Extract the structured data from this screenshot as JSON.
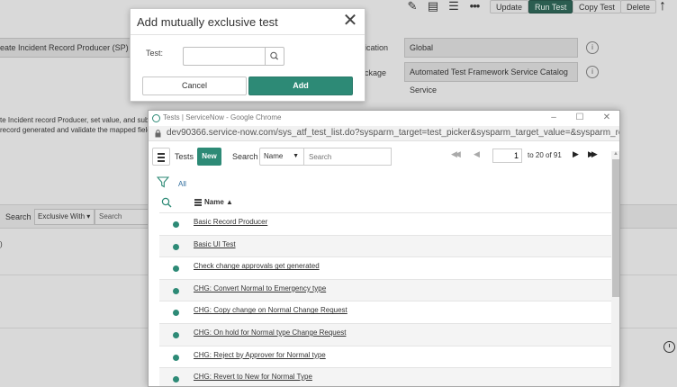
{
  "background": {
    "toolbar": {
      "update_label": "Update",
      "run_test_label": "Run Test",
      "copy_test_label": "Copy Test",
      "delete_label": "Delete"
    },
    "name_field_value": "eate Incident Record Producer (SP)",
    "application_label": "ication",
    "application_value": "Global",
    "package_label": "ckage",
    "package_value": "Automated Test Framework Service Catalog Service",
    "description_line1": "te Incident record Producer, set value, and sub",
    "description_line2": "record generated and validate the mapped field",
    "related_search_label": "Search",
    "related_search_select": "Exclusive With",
    "related_search_placeholder": "Search",
    "bracket_text": ")"
  },
  "modal": {
    "title": "Add mutually exclusive test",
    "test_label": "Test:",
    "test_value": "",
    "cancel_label": "Cancel",
    "add_label": "Add"
  },
  "popup": {
    "window_title": "Tests | ServiceNow - Google Chrome",
    "url": "dev90366.service-now.com/sys_atf_test_list.do?sysparm_target=test_picker&sysparm_target_value=&sysparm_reference...",
    "list_title": "Tests",
    "new_label": "New",
    "search_label": "Search",
    "search_field": "Name",
    "search_placeholder": "Search",
    "page_value": "1",
    "page_range": "to 20 of 91",
    "filter_all_label": "All",
    "column_name": "Name ▲",
    "rows": [
      {
        "name": "Basic Record Producer"
      },
      {
        "name": "Basic UI Test"
      },
      {
        "name": "Check change approvals get generated"
      },
      {
        "name": "CHG: Convert Normal to Emergency type"
      },
      {
        "name": "CHG: Copy change on Normal Change Request"
      },
      {
        "name": "CHG: On hold for Normal type Change Request"
      },
      {
        "name": "CHG: Reject by Approver for Normal type"
      },
      {
        "name": "CHG: Revert to New for Normal Type"
      }
    ]
  },
  "colors": {
    "accent": "#2d8a76",
    "primary_dark": "#2b5d50"
  }
}
